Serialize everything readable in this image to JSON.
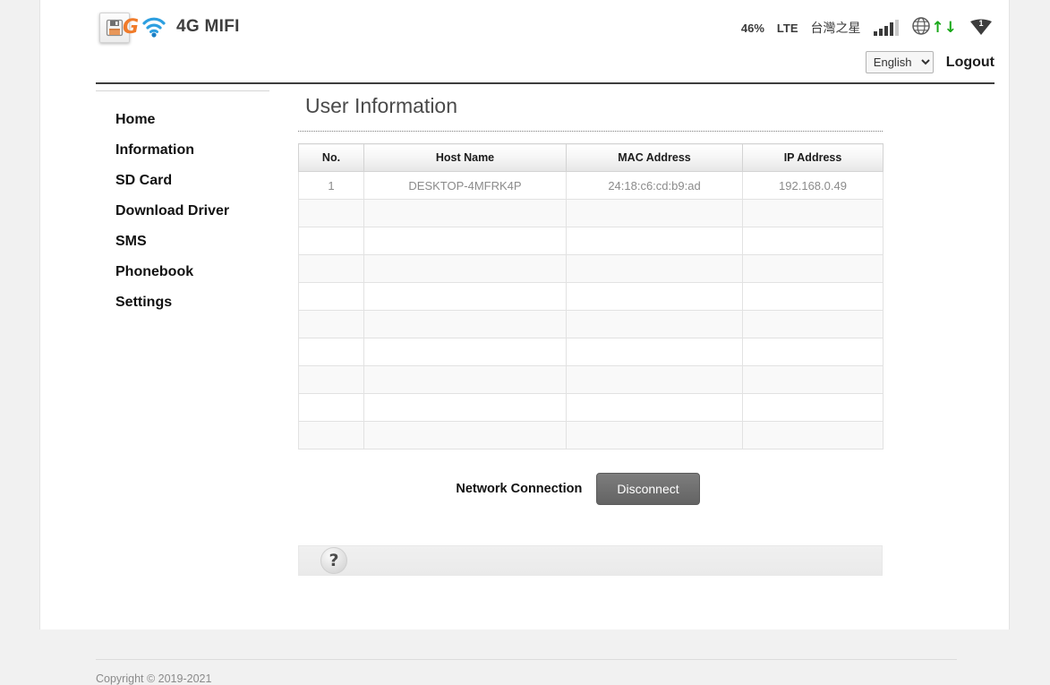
{
  "brand": {
    "title": "4G MIFI",
    "favicon_icon": "save-floppy-icon",
    "g_mark": "G",
    "wifi_icon": "wifi-icon"
  },
  "status": {
    "battery": "46%",
    "network_type": "LTE",
    "carrier": "台灣之星",
    "signal_icon": "signal-bars-icon",
    "signal_bars_on": 4,
    "signal_bars_total": 5,
    "globe_icon": "globe-icon",
    "traffic_up_icon": "arrow-up-icon",
    "traffic_down_icon": "arrow-down-icon",
    "traffic_up_glyph": "↑",
    "traffic_down_glyph": "↓",
    "clients_icon": "wifi-clients-icon",
    "clients_count": "1",
    "accent_green": "#18a818"
  },
  "header": {
    "language_selected": "English",
    "language_options": [
      "English"
    ],
    "logout_label": "Logout"
  },
  "sidebar": {
    "items": [
      {
        "label": "Home"
      },
      {
        "label": "Information"
      },
      {
        "label": "SD Card"
      },
      {
        "label": "Download Driver"
      },
      {
        "label": "SMS"
      },
      {
        "label": "Phonebook"
      },
      {
        "label": "Settings"
      }
    ]
  },
  "main": {
    "title": "User Information",
    "table": {
      "columns": [
        "No.",
        "Host Name",
        "MAC Address",
        "IP Address"
      ],
      "rows": [
        [
          "1",
          "DESKTOP-4MFRK4P",
          "24:18:c6:cd:b9:ad",
          "192.168.0.49"
        ],
        [
          "",
          "",
          "",
          ""
        ],
        [
          "",
          "",
          "",
          ""
        ],
        [
          "",
          "",
          "",
          ""
        ],
        [
          "",
          "",
          "",
          ""
        ],
        [
          "",
          "",
          "",
          ""
        ],
        [
          "",
          "",
          "",
          ""
        ],
        [
          "",
          "",
          "",
          ""
        ],
        [
          "",
          "",
          "",
          ""
        ],
        [
          "",
          "",
          "",
          ""
        ]
      ]
    },
    "connection_label": "Network Connection",
    "disconnect_label": "Disconnect",
    "help_icon": "question-mark-icon",
    "help_glyph": "?"
  },
  "footer": {
    "copyright": "Copyright © 2019-2021"
  }
}
